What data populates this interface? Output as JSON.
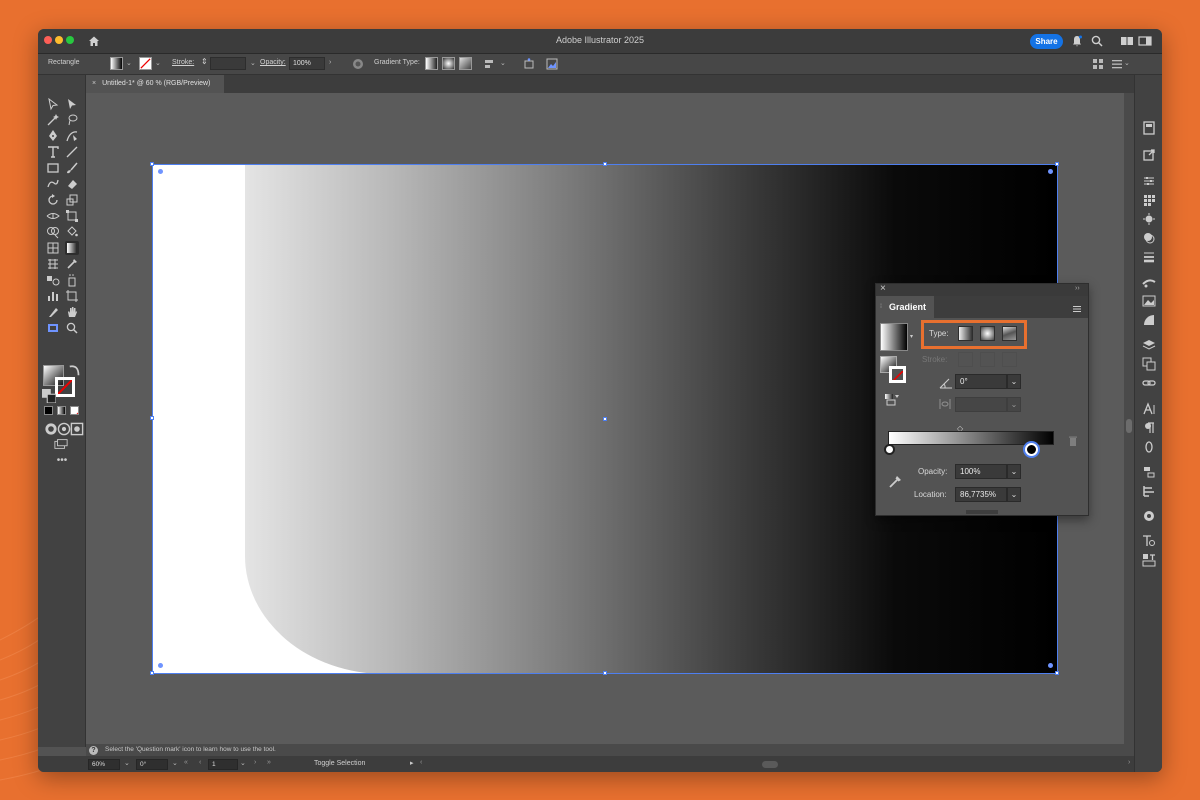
{
  "window": {
    "title": "Adobe Illustrator 2025",
    "share_label": "Share"
  },
  "control_bar": {
    "object_type": "Rectangle",
    "stroke_label": "Stroke:",
    "opacity_label": "Opacity:",
    "opacity_value": "100%",
    "gradient_type_label": "Gradient Type:"
  },
  "document_tab": {
    "close": "×",
    "title": "Untitled-1* @ 60 % (RGB/Preview)"
  },
  "gradient_panel": {
    "close": "×",
    "collapse": "››",
    "title": "Gradient",
    "type_label": "Type:",
    "stroke_label": "Stroke:",
    "angle_value": "0°",
    "opacity_label": "Opacity:",
    "opacity_value": "100%",
    "location_label": "Location:",
    "location_value": "86,7735%"
  },
  "hint_bar": {
    "text": "Select the 'Question mark' icon to learn how to use the tool."
  },
  "status_bar": {
    "zoom": "60%",
    "rotation": "0°",
    "artboard_number": "1",
    "current_tool": "Toggle Selection"
  },
  "colors": {
    "accent_highlight": "#e8702f",
    "share_blue": "#1473e6",
    "selection_blue": "#4e7ff0"
  }
}
